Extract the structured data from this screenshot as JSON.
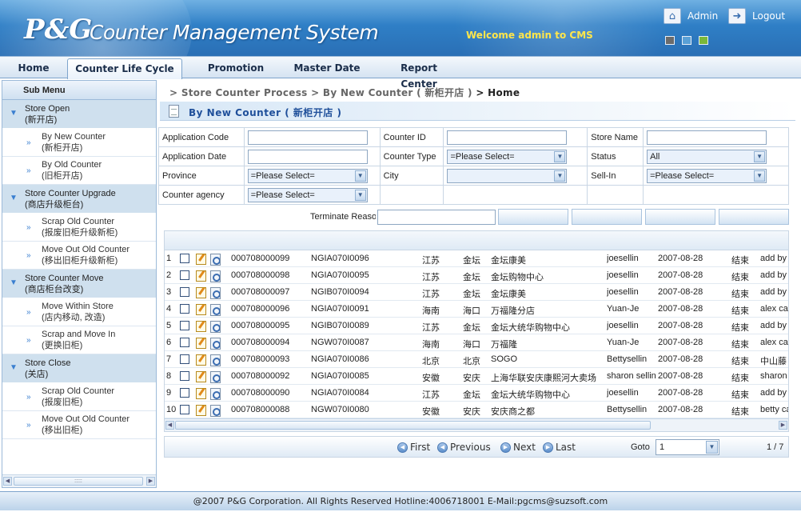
{
  "header": {
    "logo": "P&G",
    "title": "Counter Management System",
    "welcome": "Welcome admin to CMS",
    "admin_label": "Admin",
    "logout_label": "Logout",
    "swatches": [
      "#6b6b6b",
      "#5aa0d6",
      "#7ab83a"
    ]
  },
  "nav": {
    "tabs": [
      "Home",
      "Counter Life Cycle",
      "Promotion",
      "Master Date",
      "Report Center"
    ],
    "active": "Counter Life Cycle"
  },
  "sidebar": {
    "title": "Sub Menu",
    "groups": [
      {
        "line1": "Store Open",
        "line2": "(新开店)",
        "items": [
          {
            "line1": "By New Counter",
            "line2": "(新柜开店)"
          },
          {
            "line1": "By Old Counter",
            "line2": "(旧柜开店)"
          }
        ]
      },
      {
        "line1": "Store Counter Upgrade",
        "line2": "(商店升级柜台)",
        "items": [
          {
            "line1": "Scrap Old Counter",
            "line2": "(报废旧柜升级新柜)"
          },
          {
            "line1": "Move Out Old Counter",
            "line2": "(移出旧柜升级新柜)"
          }
        ]
      },
      {
        "line1": "Store Counter Move",
        "line2": "(商店柜台改变)",
        "items": [
          {
            "line1": "Move Within Store",
            "line2": "(店内移动, 改造)"
          },
          {
            "line1": "Scrap and Move In",
            "line2": "(更换旧柜)"
          }
        ]
      },
      {
        "line1": "Store Close",
        "line2": "(关店)",
        "items": [
          {
            "line1": "Scrap Old Counter",
            "line2": "(报废旧柜)"
          },
          {
            "line1": "Move Out Old Counter",
            "line2": "(移出旧柜)"
          }
        ]
      }
    ]
  },
  "breadcrumb": {
    "part1": "> Store Counter Process",
    "part2": "> By New Counter (  新柜开店  )",
    "current": "> Home"
  },
  "section_title": "By New Counter (   新柜开店   )",
  "form": {
    "application_code": {
      "label": "Application Code",
      "value": ""
    },
    "counter_id": {
      "label": "Counter ID",
      "value": ""
    },
    "store_name": {
      "label": "Store Name",
      "value": ""
    },
    "application_date": {
      "label": "Application Date",
      "value": ""
    },
    "counter_type": {
      "label": "Counter Type",
      "value": "=Please Select="
    },
    "status": {
      "label": "Status",
      "value": "All"
    },
    "province": {
      "label": "Province",
      "value": "=Please Select="
    },
    "city": {
      "label": "City",
      "value": ""
    },
    "sell_in": {
      "label": "Sell-In",
      "value": "=Please Select="
    },
    "counter_agency": {
      "label": "Counter agency",
      "value": "=Please Select="
    },
    "terminate_reason": {
      "label": "Terminate Reason",
      "value": ""
    }
  },
  "grid": {
    "rows": [
      {
        "n": "1",
        "code": "000708000099",
        "cid": "NGIA070I0096",
        "prov": "江苏",
        "city": "金坛",
        "store": "金坛康美",
        "user": "joesellin",
        "date": "2007-08-28",
        "status": "结束",
        "extra": "add by"
      },
      {
        "n": "2",
        "code": "000708000098",
        "cid": "NGIA070I0095",
        "prov": "江苏",
        "city": "金坛",
        "store": "金坛购物中心",
        "user": "joesellin",
        "date": "2007-08-28",
        "status": "结束",
        "extra": "add by"
      },
      {
        "n": "3",
        "code": "000708000097",
        "cid": "NGIB070I0094",
        "prov": "江苏",
        "city": "金坛",
        "store": "金坛康美",
        "user": "joesellin",
        "date": "2007-08-28",
        "status": "结束",
        "extra": "add by"
      },
      {
        "n": "4",
        "code": "000708000096",
        "cid": "NGIA070I0091",
        "prov": "海南",
        "city": "海口",
        "store": "万福隆分店",
        "user": "Yuan-Je",
        "date": "2007-08-28",
        "status": "结束",
        "extra": "alex ca"
      },
      {
        "n": "5",
        "code": "000708000095",
        "cid": "NGIB070I0089",
        "prov": "江苏",
        "city": "金坛",
        "store": "金坛大统华购物中心",
        "user": "joesellin",
        "date": "2007-08-28",
        "status": "结束",
        "extra": "add by"
      },
      {
        "n": "6",
        "code": "000708000094",
        "cid": "NGW070I0087",
        "prov": "海南",
        "city": "海口",
        "store": "万福隆",
        "user": "Yuan-Je",
        "date": "2007-08-28",
        "status": "结束",
        "extra": "alex ca"
      },
      {
        "n": "7",
        "code": "000708000093",
        "cid": "NGIA070I0086",
        "prov": "北京",
        "city": "北京",
        "store": "SOGO",
        "user": "Bettysellin",
        "date": "2007-08-28",
        "status": "结束",
        "extra": "中山藤"
      },
      {
        "n": "8",
        "code": "000708000092",
        "cid": "NGIA070I0085",
        "prov": "安徽",
        "city": "安庆",
        "store": "上海华联安庆康熙河大卖场",
        "user": "sharon sellin",
        "date": "2007-08-28",
        "status": "结束",
        "extra": "sharon"
      },
      {
        "n": "9",
        "code": "000708000090",
        "cid": "NGIA070I0084",
        "prov": "江苏",
        "city": "金坛",
        "store": "金坛大统华购物中心",
        "user": "joesellin",
        "date": "2007-08-28",
        "status": "结束",
        "extra": "add by"
      },
      {
        "n": "10",
        "code": "000708000088",
        "cid": "NGW070I0080",
        "prov": "安徽",
        "city": "安庆",
        "store": "安庆商之都",
        "user": "Bettysellin",
        "date": "2007-08-28",
        "status": "结束",
        "extra": "betty ca"
      }
    ]
  },
  "pager": {
    "first": "First",
    "previous": "Previous",
    "next": "Next",
    "last": "Last",
    "goto_label": "Goto",
    "goto_value": "1",
    "pages": "1 / 7"
  },
  "footer": "@2007 P&G Corporation. All Rights Reserved Hotline:4006718001 E-Mail:pgcms@suzsoft.com"
}
